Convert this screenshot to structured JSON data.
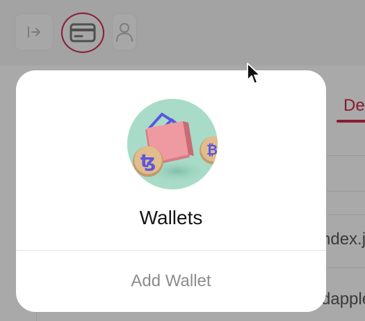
{
  "header": {
    "buttons": [
      {
        "name": "sidebar-toggle",
        "icon": "sidebar-expand-icon"
      },
      {
        "name": "wallets",
        "icon": "credit-card-icon",
        "active": true
      },
      {
        "name": "profile",
        "icon": "user-icon"
      }
    ],
    "active_color": "#8a1c34"
  },
  "background": {
    "tab_label": "De",
    "files": [
      "ndex.j",
      "dapple"
    ]
  },
  "popup": {
    "illustration": "wallet-with-coins-illustration",
    "title": "Wallets",
    "action_label": "Add Wallet"
  },
  "colors": {
    "accent": "#8a1a30",
    "overlay": "#a9a9a9",
    "popup_bg": "#ffffff",
    "action_text": "#8c8c8c"
  }
}
